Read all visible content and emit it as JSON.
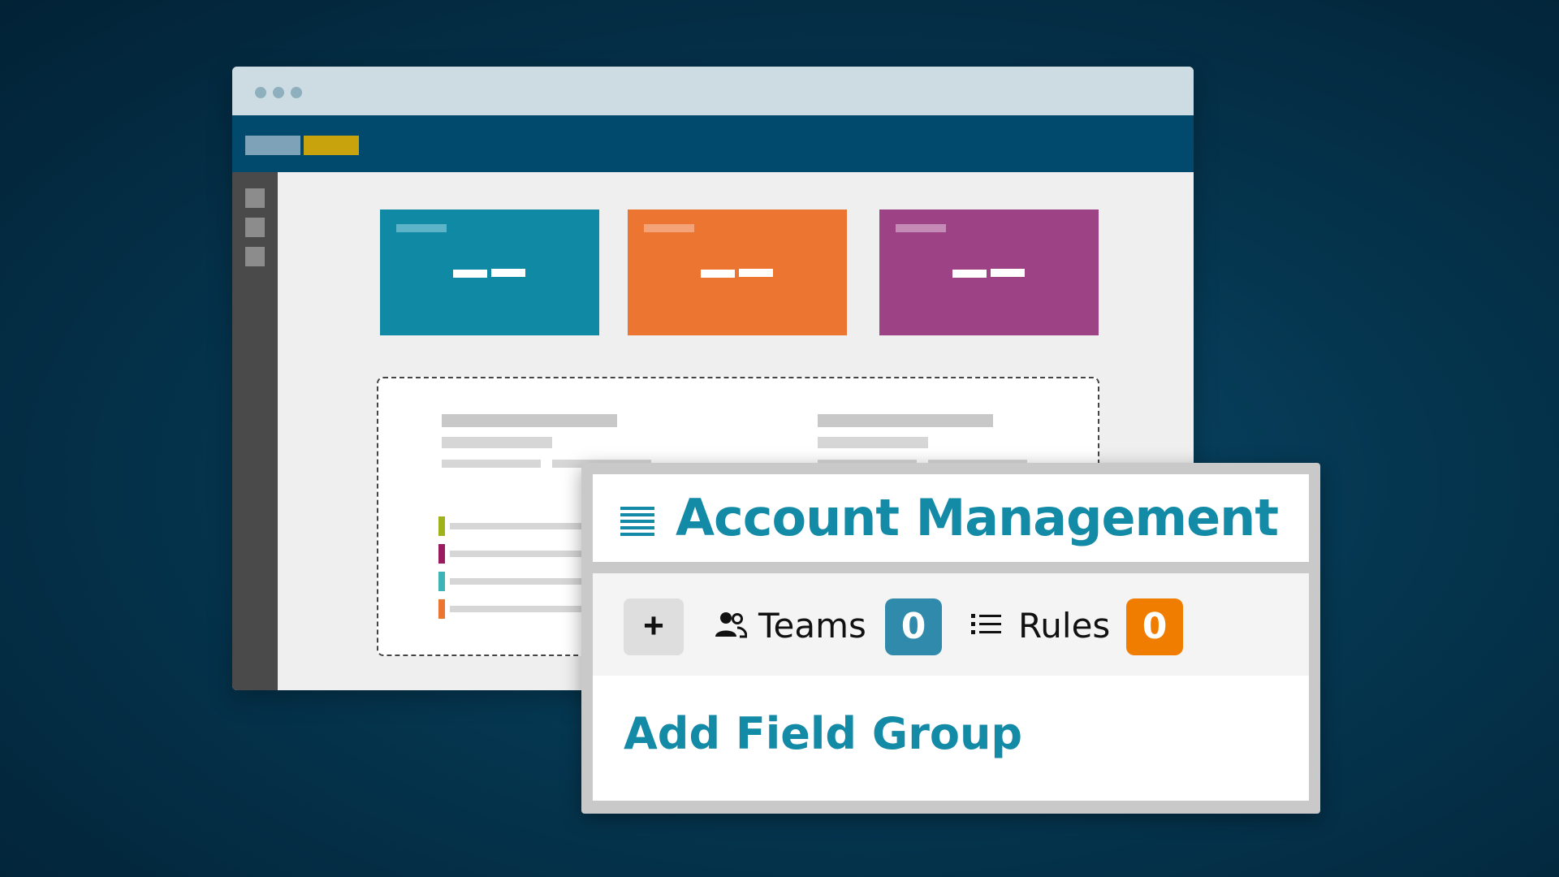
{
  "panel": {
    "title": "Account Management",
    "add_button_label": "+",
    "teams_label": "Teams",
    "teams_count": "0",
    "rules_label": "Rules",
    "rules_count": "0",
    "add_field_group_label": "Add Field Group"
  },
  "icons": {
    "menu": "menu-icon",
    "teams": "people-icon",
    "rules": "list-icon"
  },
  "colors": {
    "accent": "#138aa6",
    "teams_badge": "#2f8aab",
    "rules_badge": "#f07d00",
    "card_teal": "#1089a4",
    "card_orange": "#ec7532",
    "card_purple": "#9c4285",
    "logo_gold": "#c8a30e"
  }
}
